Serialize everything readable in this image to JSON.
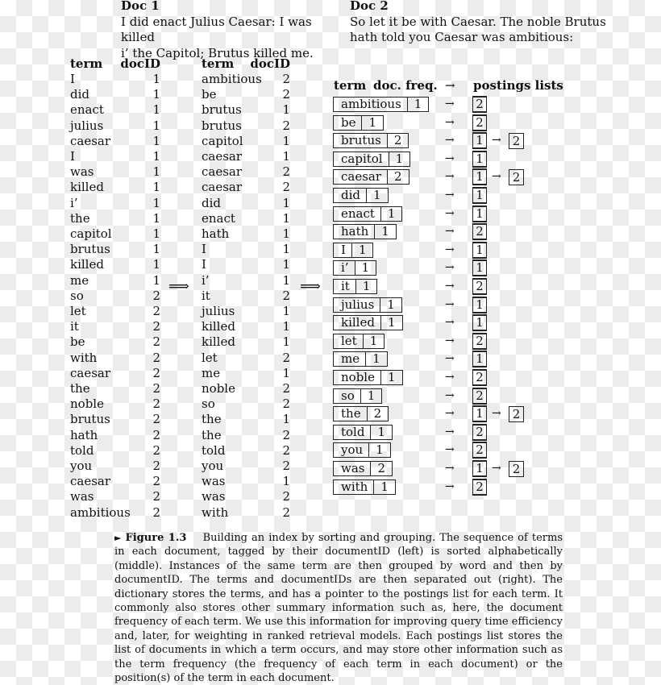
{
  "doc1": {
    "heading": "Doc 1",
    "lines": [
      "I did enact Julius Caesar: I was killed",
      "i’ the Capitol; Brutus killed me."
    ]
  },
  "doc2": {
    "heading": "Doc 2",
    "lines": [
      "So let it be with Caesar.  The noble Brutus",
      "hath told you Caesar was ambitious:"
    ]
  },
  "left_table": {
    "headers": {
      "term": "term",
      "docid": "docID"
    },
    "rows": [
      {
        "term": "I",
        "docid": "1"
      },
      {
        "term": "did",
        "docid": "1"
      },
      {
        "term": "enact",
        "docid": "1"
      },
      {
        "term": "julius",
        "docid": "1"
      },
      {
        "term": "caesar",
        "docid": "1"
      },
      {
        "term": "I",
        "docid": "1"
      },
      {
        "term": "was",
        "docid": "1"
      },
      {
        "term": "killed",
        "docid": "1"
      },
      {
        "term": "i’",
        "docid": "1"
      },
      {
        "term": "the",
        "docid": "1"
      },
      {
        "term": "capitol",
        "docid": "1"
      },
      {
        "term": "brutus",
        "docid": "1"
      },
      {
        "term": "killed",
        "docid": "1"
      },
      {
        "term": "me",
        "docid": "1"
      },
      {
        "term": "so",
        "docid": "2"
      },
      {
        "term": "let",
        "docid": "2"
      },
      {
        "term": "it",
        "docid": "2"
      },
      {
        "term": "be",
        "docid": "2"
      },
      {
        "term": "with",
        "docid": "2"
      },
      {
        "term": "caesar",
        "docid": "2"
      },
      {
        "term": "the",
        "docid": "2"
      },
      {
        "term": "noble",
        "docid": "2"
      },
      {
        "term": "brutus",
        "docid": "2"
      },
      {
        "term": "hath",
        "docid": "2"
      },
      {
        "term": "told",
        "docid": "2"
      },
      {
        "term": "you",
        "docid": "2"
      },
      {
        "term": "caesar",
        "docid": "2"
      },
      {
        "term": "was",
        "docid": "2"
      },
      {
        "term": "ambitious",
        "docid": "2"
      }
    ]
  },
  "middle_table": {
    "headers": {
      "term": "term",
      "docid": "docID"
    },
    "rows": [
      {
        "term": "ambitious",
        "docid": "2"
      },
      {
        "term": "be",
        "docid": "2"
      },
      {
        "term": "brutus",
        "docid": "1"
      },
      {
        "term": "brutus",
        "docid": "2"
      },
      {
        "term": "capitol",
        "docid": "1"
      },
      {
        "term": "caesar",
        "docid": "1"
      },
      {
        "term": "caesar",
        "docid": "2"
      },
      {
        "term": "caesar",
        "docid": "2"
      },
      {
        "term": "did",
        "docid": "1"
      },
      {
        "term": "enact",
        "docid": "1"
      },
      {
        "term": "hath",
        "docid": "1"
      },
      {
        "term": "I",
        "docid": "1"
      },
      {
        "term": "I",
        "docid": "1"
      },
      {
        "term": "i’",
        "docid": "1"
      },
      {
        "term": "it",
        "docid": "2"
      },
      {
        "term": "julius",
        "docid": "1"
      },
      {
        "term": "killed",
        "docid": "1"
      },
      {
        "term": "killed",
        "docid": "1"
      },
      {
        "term": "let",
        "docid": "2"
      },
      {
        "term": "me",
        "docid": "1"
      },
      {
        "term": "noble",
        "docid": "2"
      },
      {
        "term": "so",
        "docid": "2"
      },
      {
        "term": "the",
        "docid": "1"
      },
      {
        "term": "the",
        "docid": "2"
      },
      {
        "term": "told",
        "docid": "2"
      },
      {
        "term": "you",
        "docid": "2"
      },
      {
        "term": "was",
        "docid": "1"
      },
      {
        "term": "was",
        "docid": "2"
      },
      {
        "term": "with",
        "docid": "2"
      }
    ]
  },
  "transform_arrow": "⟹",
  "dictionary": {
    "headers": {
      "term": "term",
      "freq": "doc. freq.",
      "arrow": "→",
      "postings": "postings lists"
    },
    "arrow": "→",
    "rows": [
      {
        "term": "ambitious",
        "freq": "1",
        "postings": [
          "2"
        ]
      },
      {
        "term": "be",
        "freq": "1",
        "postings": [
          "2"
        ]
      },
      {
        "term": "brutus",
        "freq": "2",
        "postings": [
          "1",
          "2"
        ]
      },
      {
        "term": "capitol",
        "freq": "1",
        "postings": [
          "1"
        ]
      },
      {
        "term": "caesar",
        "freq": "2",
        "postings": [
          "1",
          "2"
        ]
      },
      {
        "term": "did",
        "freq": "1",
        "postings": [
          "1"
        ]
      },
      {
        "term": "enact",
        "freq": "1",
        "postings": [
          "1"
        ]
      },
      {
        "term": "hath",
        "freq": "1",
        "postings": [
          "2"
        ]
      },
      {
        "term": "I",
        "freq": "1",
        "postings": [
          "1"
        ]
      },
      {
        "term": "i’",
        "freq": "1",
        "postings": [
          "1"
        ]
      },
      {
        "term": "it",
        "freq": "1",
        "postings": [
          "2"
        ]
      },
      {
        "term": "julius",
        "freq": "1",
        "postings": [
          "1"
        ]
      },
      {
        "term": "killed",
        "freq": "1",
        "postings": [
          "1"
        ]
      },
      {
        "term": "let",
        "freq": "1",
        "postings": [
          "2"
        ]
      },
      {
        "term": "me",
        "freq": "1",
        "postings": [
          "1"
        ]
      },
      {
        "term": "noble",
        "freq": "1",
        "postings": [
          "2"
        ]
      },
      {
        "term": "so",
        "freq": "1",
        "postings": [
          "2"
        ]
      },
      {
        "term": "the",
        "freq": "2",
        "postings": [
          "1",
          "2"
        ]
      },
      {
        "term": "told",
        "freq": "1",
        "postings": [
          "2"
        ]
      },
      {
        "term": "you",
        "freq": "1",
        "postings": [
          "2"
        ]
      },
      {
        "term": "was",
        "freq": "2",
        "postings": [
          "1",
          "2"
        ]
      },
      {
        "term": "with",
        "freq": "1",
        "postings": [
          "2"
        ]
      }
    ]
  },
  "caption": {
    "marker": "►",
    "label": "Figure 1.3",
    "text": "Building an index by sorting and grouping. The sequence of terms in each document, tagged by their documentID (left) is sorted alphabetically (middle). Instances of the same term are then grouped by word and then by documentID. The terms and documentIDs are then separated out (right).  The dictionary stores the terms, and has a pointer to the postings list for each term.  It commonly also stores other summary information such as, here, the document frequency of each term. We use this information for improving query time efficiency and, later, for weighting in ranked retrieval models. Each postings list stores the list of documents in which a term occurs, and may store other information such as the term frequency (the frequency of each term in each document) or the position(s) of the term in each document."
  }
}
